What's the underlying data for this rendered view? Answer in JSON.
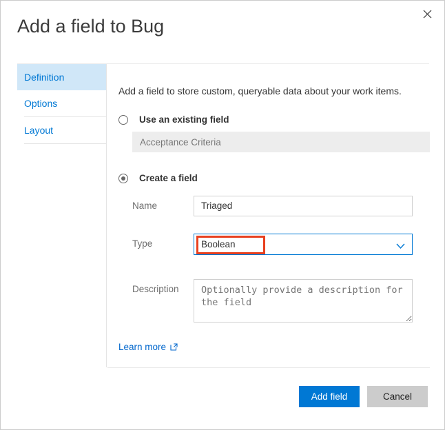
{
  "dialog": {
    "title": "Add a field to Bug",
    "close_icon": "close-icon"
  },
  "sidebar": {
    "items": [
      {
        "label": "Definition",
        "selected": true
      },
      {
        "label": "Options",
        "selected": false
      },
      {
        "label": "Layout",
        "selected": false
      }
    ]
  },
  "main": {
    "intro": "Add a field to store custom, queryable data about your work items.",
    "existing_field": {
      "radio_label": "Use an existing field",
      "selected": false,
      "value": "Acceptance Criteria"
    },
    "create_field": {
      "radio_label": "Create a field",
      "selected": true,
      "name_label": "Name",
      "name_value": "Triaged",
      "name_placeholder": "Name",
      "type_label": "Type",
      "type_value": "Boolean",
      "type_chevron_icon": "chevron-down-icon",
      "description_label": "Description",
      "description_value": "",
      "description_placeholder": "Optionally provide a description for the field"
    },
    "learn_more": {
      "label": "Learn more",
      "icon": "external-link-icon"
    }
  },
  "footer": {
    "primary_label": "Add field",
    "secondary_label": "Cancel"
  },
  "colors": {
    "accent": "#0078d4",
    "nav_selected_bg": "#d0e7f8",
    "link": "#0066cc",
    "highlight": "#e8401f",
    "disabled_bg": "#ededed",
    "secondary_button_bg": "#cccccc"
  }
}
